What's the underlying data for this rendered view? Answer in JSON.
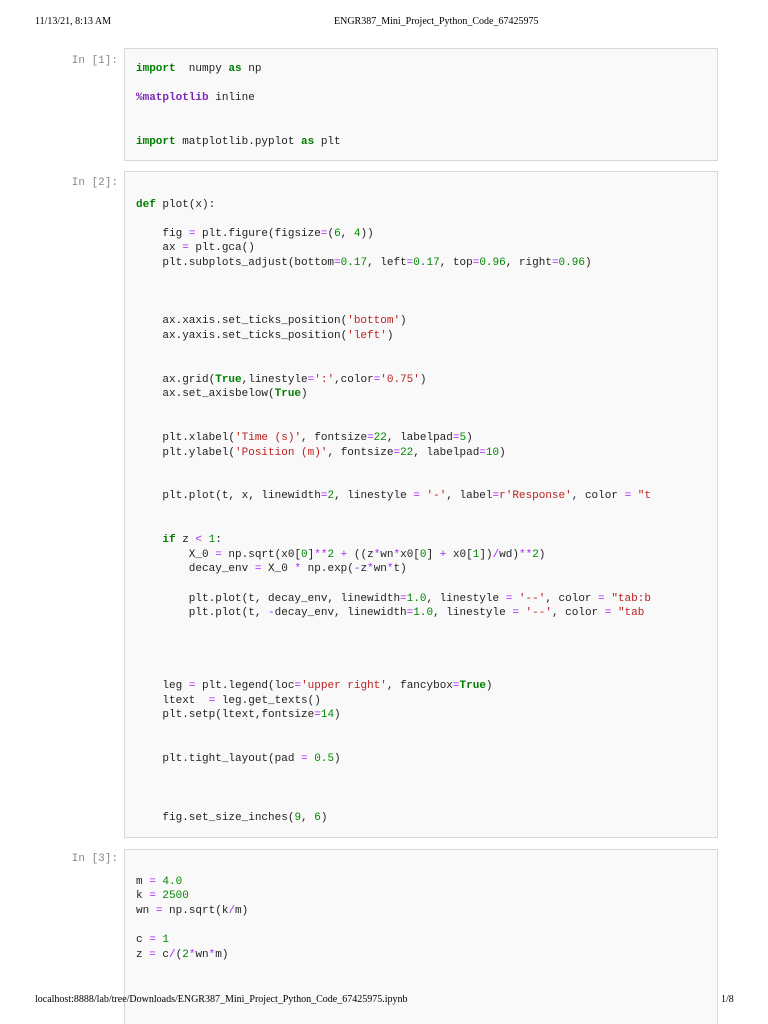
{
  "header": {
    "datetime": "11/13/21, 8:13 AM",
    "title": "ENGR387_Mini_Project_Python_Code_67425975"
  },
  "footer": {
    "url": "localhost:8888/lab/tree/Downloads/ENGR387_Mini_Project_Python_Code_67425975.ipynb",
    "page": "1/8"
  },
  "cells": [
    {
      "prompt": "In [1]:",
      "lines": [
        [
          [
            "k",
            "import"
          ],
          [
            "",
            "  numpy "
          ],
          [
            "k",
            "as"
          ],
          [
            "",
            " np"
          ]
        ],
        [],
        [
          [
            "m",
            "%matplotlib"
          ],
          [
            "",
            " inline"
          ]
        ],
        [],
        [],
        [
          [
            "k",
            "import"
          ],
          [
            "",
            " matplotlib.pyplot "
          ],
          [
            "k",
            "as"
          ],
          [
            "",
            " plt"
          ]
        ]
      ]
    },
    {
      "prompt": "In [2]:",
      "lines": [
        [],
        [
          [
            "k",
            "def"
          ],
          [
            "",
            " plot(x):"
          ]
        ],
        [],
        [
          [
            "",
            "    fig "
          ],
          [
            "o",
            "="
          ],
          [
            "",
            " plt.figure(figsize"
          ],
          [
            "o",
            "="
          ],
          [
            "",
            "("
          ],
          [
            "num",
            "6"
          ],
          [
            "",
            ", "
          ],
          [
            "num",
            "4"
          ],
          [
            "",
            "))"
          ]
        ],
        [
          [
            "",
            "    ax "
          ],
          [
            "o",
            "="
          ],
          [
            "",
            " plt.gca()"
          ]
        ],
        [
          [
            "",
            "    plt.subplots_adjust(bottom"
          ],
          [
            "o",
            "="
          ],
          [
            "num",
            "0.17"
          ],
          [
            "",
            ", left"
          ],
          [
            "o",
            "="
          ],
          [
            "num",
            "0.17"
          ],
          [
            "",
            ", top"
          ],
          [
            "o",
            "="
          ],
          [
            "num",
            "0.96"
          ],
          [
            "",
            ", right"
          ],
          [
            "o",
            "="
          ],
          [
            "num",
            "0.96"
          ],
          [
            "",
            ")"
          ]
        ],
        [],
        [],
        [],
        [
          [
            "",
            "    ax.xaxis.set_ticks_position("
          ],
          [
            "s",
            "'bottom'"
          ],
          [
            "",
            ")"
          ]
        ],
        [
          [
            "",
            "    ax.yaxis.set_ticks_position("
          ],
          [
            "s",
            "'left'"
          ],
          [
            "",
            ")"
          ]
        ],
        [],
        [],
        [
          [
            "",
            "    ax.grid("
          ],
          [
            "k",
            "True"
          ],
          [
            "",
            ",linestyle"
          ],
          [
            "o",
            "="
          ],
          [
            "s",
            "':'"
          ],
          [
            "",
            ",color"
          ],
          [
            "o",
            "="
          ],
          [
            "s",
            "'0.75'"
          ],
          [
            "",
            ")"
          ]
        ],
        [
          [
            "",
            "    ax.set_axisbelow("
          ],
          [
            "k",
            "True"
          ],
          [
            "",
            ")"
          ]
        ],
        [],
        [],
        [
          [
            "",
            "    plt.xlabel("
          ],
          [
            "s",
            "'Time (s)'"
          ],
          [
            "",
            ", fontsize"
          ],
          [
            "o",
            "="
          ],
          [
            "num",
            "22"
          ],
          [
            "",
            ", labelpad"
          ],
          [
            "o",
            "="
          ],
          [
            "num",
            "5"
          ],
          [
            "",
            ")"
          ]
        ],
        [
          [
            "",
            "    plt.ylabel("
          ],
          [
            "s",
            "'Position (m)'"
          ],
          [
            "",
            ", fontsize"
          ],
          [
            "o",
            "="
          ],
          [
            "num",
            "22"
          ],
          [
            "",
            ", labelpad"
          ],
          [
            "o",
            "="
          ],
          [
            "num",
            "10"
          ],
          [
            "",
            ")"
          ]
        ],
        [],
        [],
        [
          [
            "",
            "    plt.plot(t, x, linewidth"
          ],
          [
            "o",
            "="
          ],
          [
            "num",
            "2"
          ],
          [
            "",
            ", linestyle "
          ],
          [
            "o",
            "="
          ],
          [
            "",
            ""
          ],
          [
            "s",
            " '-'"
          ],
          [
            "",
            ", label"
          ],
          [
            "o",
            "="
          ],
          [
            "s",
            "r'Response'"
          ],
          [
            "",
            ", color "
          ],
          [
            "o",
            "="
          ],
          [
            "s",
            " \"t"
          ]
        ],
        [],
        [],
        [
          [
            "k",
            "    if"
          ],
          [
            "",
            " z "
          ],
          [
            "o",
            "<"
          ],
          [
            "num",
            " 1"
          ],
          [
            "",
            ":"
          ]
        ],
        [
          [
            "",
            "        X_0 "
          ],
          [
            "o",
            "="
          ],
          [
            "",
            " np.sqrt(x0["
          ],
          [
            "num",
            "0"
          ],
          [
            "",
            "]"
          ],
          [
            "o",
            "**"
          ],
          [
            "num",
            "2"
          ],
          [
            "o",
            " +"
          ],
          [
            "",
            " ((z"
          ],
          [
            "o",
            "*"
          ],
          [
            "",
            "wn"
          ],
          [
            "o",
            "*"
          ],
          [
            "",
            "x0["
          ],
          [
            "num",
            "0"
          ],
          [
            "",
            "] "
          ],
          [
            "o",
            "+"
          ],
          [
            "",
            " x0["
          ],
          [
            "num",
            "1"
          ],
          [
            "",
            "])"
          ],
          [
            "o",
            "/"
          ],
          [
            "",
            "wd)"
          ],
          [
            "o",
            "**"
          ],
          [
            "num",
            "2"
          ],
          [
            "",
            ")"
          ]
        ],
        [
          [
            "",
            "        decay_env "
          ],
          [
            "o",
            "="
          ],
          [
            "",
            " X_0 "
          ],
          [
            "o",
            "*"
          ],
          [
            "",
            " np.exp("
          ],
          [
            "o",
            "-"
          ],
          [
            "",
            "z"
          ],
          [
            "o",
            "*"
          ],
          [
            "",
            "wn"
          ],
          [
            "o",
            "*"
          ],
          [
            "",
            "t)"
          ]
        ],
        [],
        [
          [
            "",
            "        plt.plot(t, decay_env, linewidth"
          ],
          [
            "o",
            "="
          ],
          [
            "num",
            "1.0"
          ],
          [
            "",
            ", linestyle "
          ],
          [
            "o",
            "="
          ],
          [
            "s",
            " '--'"
          ],
          [
            "",
            ", color "
          ],
          [
            "o",
            "="
          ],
          [
            "s",
            " \"tab:b"
          ]
        ],
        [
          [
            "",
            "        plt.plot(t, "
          ],
          [
            "o",
            "-"
          ],
          [
            "",
            "decay_env, linewidth"
          ],
          [
            "o",
            "="
          ],
          [
            "num",
            "1.0"
          ],
          [
            "",
            ", linestyle "
          ],
          [
            "o",
            "="
          ],
          [
            "s",
            " '--'"
          ],
          [
            "",
            ", color "
          ],
          [
            "o",
            "="
          ],
          [
            "s",
            " \"tab"
          ]
        ],
        [],
        [],
        [],
        [],
        [
          [
            "",
            "    leg "
          ],
          [
            "o",
            "="
          ],
          [
            "",
            " plt.legend(loc"
          ],
          [
            "o",
            "="
          ],
          [
            "s",
            "'upper right'"
          ],
          [
            "",
            ", fancybox"
          ],
          [
            "o",
            "="
          ],
          [
            "k",
            "True"
          ],
          [
            "",
            ")"
          ]
        ],
        [
          [
            "",
            "    ltext  "
          ],
          [
            "o",
            "="
          ],
          [
            "",
            " leg.get_texts()"
          ]
        ],
        [
          [
            "",
            "    plt.setp(ltext,fontsize"
          ],
          [
            "o",
            "="
          ],
          [
            "num",
            "14"
          ],
          [
            "",
            ")"
          ]
        ],
        [],
        [],
        [
          [
            "",
            "    plt.tight_layout(pad "
          ],
          [
            "o",
            "="
          ],
          [
            "num",
            " 0.5"
          ],
          [
            "",
            ")"
          ]
        ],
        [],
        [],
        [],
        [
          [
            "",
            "    fig.set_size_inches("
          ],
          [
            "num",
            "9"
          ],
          [
            "",
            ", "
          ],
          [
            "num",
            "6"
          ],
          [
            "",
            ")"
          ]
        ]
      ]
    },
    {
      "prompt": "In [3]:",
      "lines": [
        [],
        [
          [
            "",
            "m "
          ],
          [
            "o",
            "="
          ],
          [
            "num",
            " 4.0"
          ]
        ],
        [
          [
            "",
            "k "
          ],
          [
            "o",
            "="
          ],
          [
            "num",
            " 2500"
          ]
        ],
        [
          [
            "",
            "wn "
          ],
          [
            "o",
            "="
          ],
          [
            "",
            " np.sqrt(k"
          ],
          [
            "o",
            "/"
          ],
          [
            "",
            "m)"
          ]
        ],
        [],
        [
          [
            "",
            "c "
          ],
          [
            "o",
            "="
          ],
          [
            "num",
            " 1"
          ]
        ],
        [
          [
            "",
            "z "
          ],
          [
            "o",
            "="
          ],
          [
            "",
            " c"
          ],
          [
            "o",
            "/"
          ],
          [
            "",
            "("
          ],
          [
            "num",
            "2"
          ],
          [
            "o",
            "*"
          ],
          [
            "",
            "wn"
          ],
          [
            "o",
            "*"
          ],
          [
            "",
            "m)"
          ]
        ]
      ]
    }
  ]
}
